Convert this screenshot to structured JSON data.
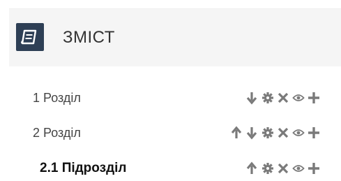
{
  "header": {
    "title": "ЗМІСТ",
    "icon": "book-icon"
  },
  "sections": [
    {
      "label": "1 Розділ",
      "bold": false,
      "actions": [
        "arrow-down-icon",
        "gear-icon",
        "close-icon",
        "eye-icon",
        "plus-icon"
      ]
    },
    {
      "label": "2 Розділ",
      "bold": false,
      "actions": [
        "arrow-up-icon",
        "arrow-down-icon",
        "gear-icon",
        "close-icon",
        "eye-icon",
        "plus-icon"
      ]
    },
    {
      "label": "2.1 Підрозділ",
      "bold": true,
      "actions": [
        "arrow-up-icon",
        "gear-icon",
        "close-icon",
        "eye-icon",
        "plus-icon"
      ]
    }
  ],
  "colors": {
    "icon_gray": "#7a7a7a",
    "header_bg": "#f5f5f5",
    "header_icon_bg": "#2e3f55"
  }
}
